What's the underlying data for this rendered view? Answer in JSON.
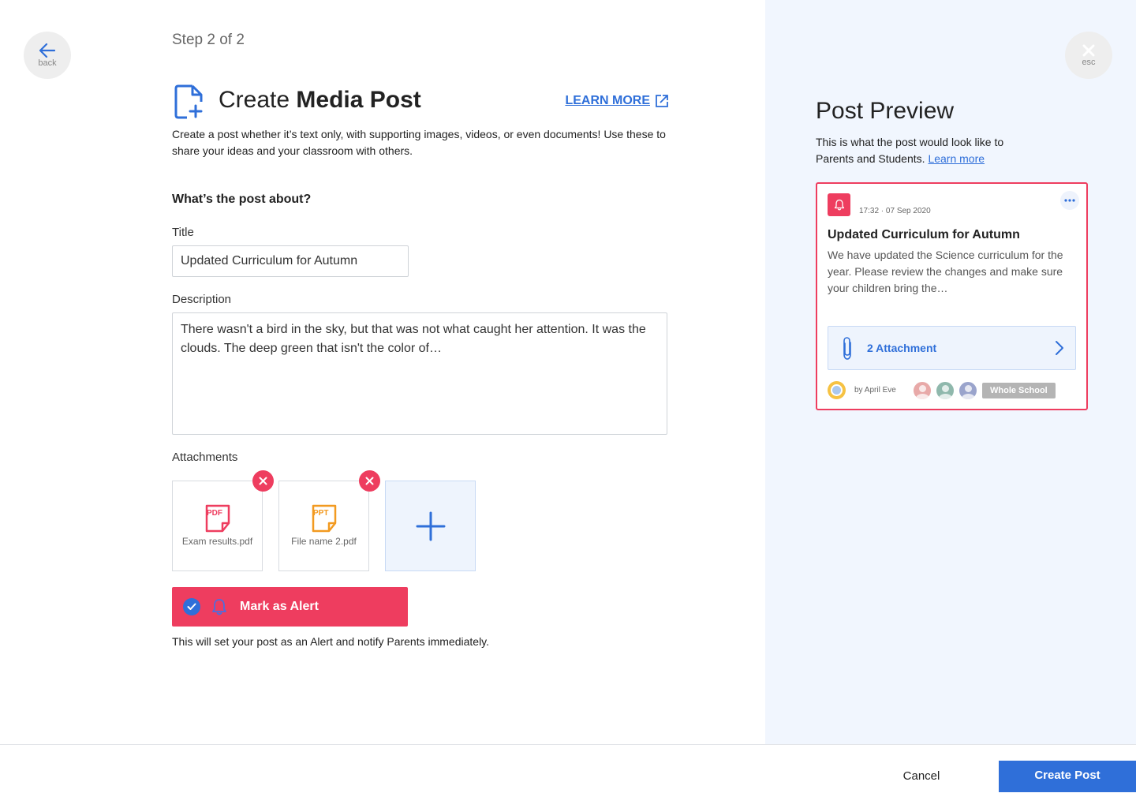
{
  "nav": {
    "back_label": "back",
    "esc_label": "esc"
  },
  "step": "Step 2 of 2",
  "header": {
    "title_prefix": "Create ",
    "title_bold": "Media Post",
    "learn_more": "LEARN MORE",
    "intro": "Create a post whether it’s text only, with supporting images, videos, or even documents! Use these to share your ideas and your classroom with others."
  },
  "form": {
    "section_question": "What’s the post about?",
    "title_label": "Title",
    "title_value": "Updated Curriculum for Autumn",
    "description_label": "Description",
    "description_value": "There wasn't a bird in the sky, but that was not what caught her attention. It was the clouds. The deep green that isn't the color of…",
    "attachments_label": "Attachments",
    "attachments": [
      {
        "name": "Exam results.pdf",
        "type": "PDF",
        "color": "#ee3d5f"
      },
      {
        "name": "File name 2.pdf",
        "type": "PPT",
        "color": "#f29a20"
      }
    ],
    "alert_label": "Mark as Alert",
    "alert_checked": true,
    "alert_note": "This will set your post as an Alert and notify Parents immediately."
  },
  "preview": {
    "title": "Post Preview",
    "subtitle": "This is what the post would look like to Parents and Students.",
    "learn_more": "Learn more",
    "card": {
      "timestamp": "17:32 · 07 Sep 2020",
      "title": "Updated Curriculum for Autumn",
      "body": "We have updated the Science curriculum for the year. Please review the changes and make sure your children bring the…",
      "attachments_label": "2 Attachments",
      "author": "by April Eve",
      "audience": "Whole School"
    }
  },
  "footer": {
    "cancel": "Cancel",
    "create": "Create Post"
  },
  "colors": {
    "accent": "#2f6fd9",
    "alert": "#ee3d5f",
    "preview_bg": "#f1f6fe"
  }
}
